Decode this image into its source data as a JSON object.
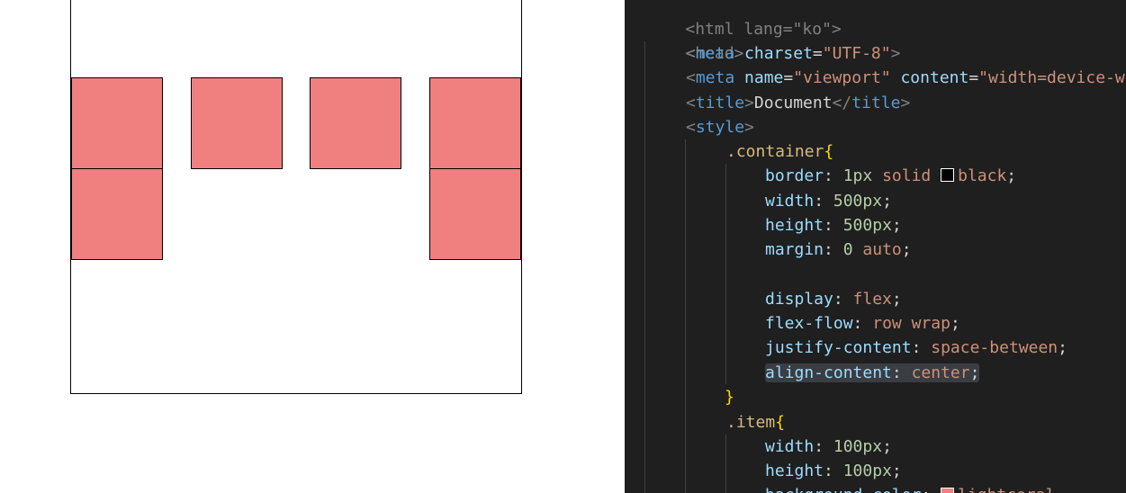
{
  "preview": {
    "container_border": "#000000",
    "item_color": "#f08080",
    "item_count": 6
  },
  "code": {
    "html_open": "<html lang=\"ko\">",
    "head_open": "<head>",
    "meta1_tag": "meta",
    "meta1_attr": "charset",
    "meta1_val": "\"UTF-8\"",
    "meta2_tag": "meta",
    "meta2_attr1": "name",
    "meta2_val1": "\"viewport\"",
    "meta2_attr2": "content",
    "meta2_val2": "\"width=device-w",
    "title_tag": "title",
    "title_text": "Document",
    "style_tag": "style",
    "container_selector": ".container",
    "border_prop": "border",
    "border_num": "1px",
    "border_style": "solid",
    "border_color_name": "black",
    "border_color_hex": "#000000",
    "width_prop": "width",
    "width_val": "500px",
    "height_prop": "height",
    "height_val": "500px",
    "margin_prop": "margin",
    "margin_num": "0",
    "margin_auto": "auto",
    "display_prop": "display",
    "display_val": "flex",
    "flexflow_prop": "flex-flow",
    "flexflow_val": "row wrap",
    "justify_prop": "justify-content",
    "justify_val": "space-between",
    "align_prop": "align-content",
    "align_val": "center",
    "close_brace": "}",
    "item_selector": ".item",
    "item_width_prop": "width",
    "item_width_val": "100px",
    "item_height_prop": "height",
    "item_height_val": "100px",
    "bg_prop": "background-color",
    "bg_val": "lightcoral",
    "bg_color_hex": "#f08080"
  },
  "colors": {
    "editor_bg": "#1f1f1f",
    "tag": "#569cd6",
    "attr": "#9cdcfe",
    "string": "#ce9178",
    "selector": "#d7ba7d",
    "brace": "#ffd700",
    "number": "#b5cea8"
  }
}
